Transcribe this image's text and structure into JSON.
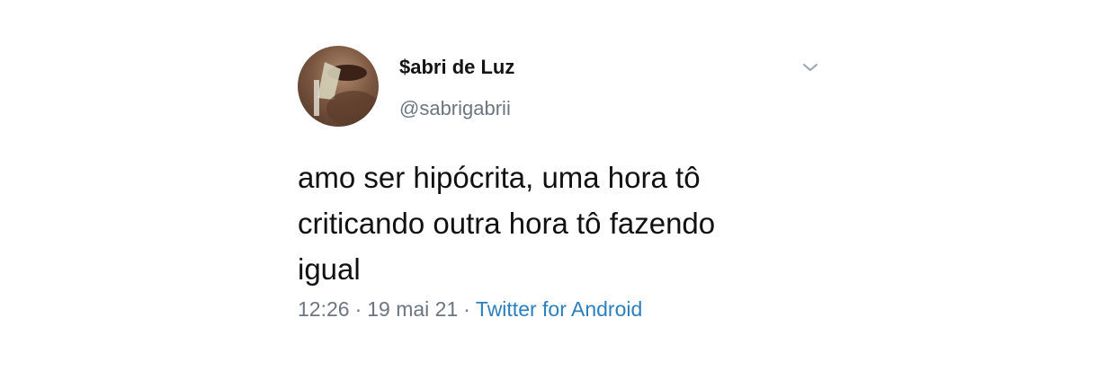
{
  "tweet": {
    "author": {
      "display_name": "$abri de Luz",
      "handle": "@sabrigabrii"
    },
    "text_lines": [
      "amo ser hipócrita, uma hora tô",
      "criticando outra hora tô fazendo",
      "igual"
    ],
    "time": "12:26",
    "separator": "·",
    "date": "19 mai 21",
    "source": "Twitter for Android"
  },
  "icons": {
    "menu": "chevron-down-icon"
  },
  "colors": {
    "name_text": "#141414",
    "secondary_text": "#6c7680",
    "link": "#2c7fbf",
    "background": "#ffffff"
  }
}
